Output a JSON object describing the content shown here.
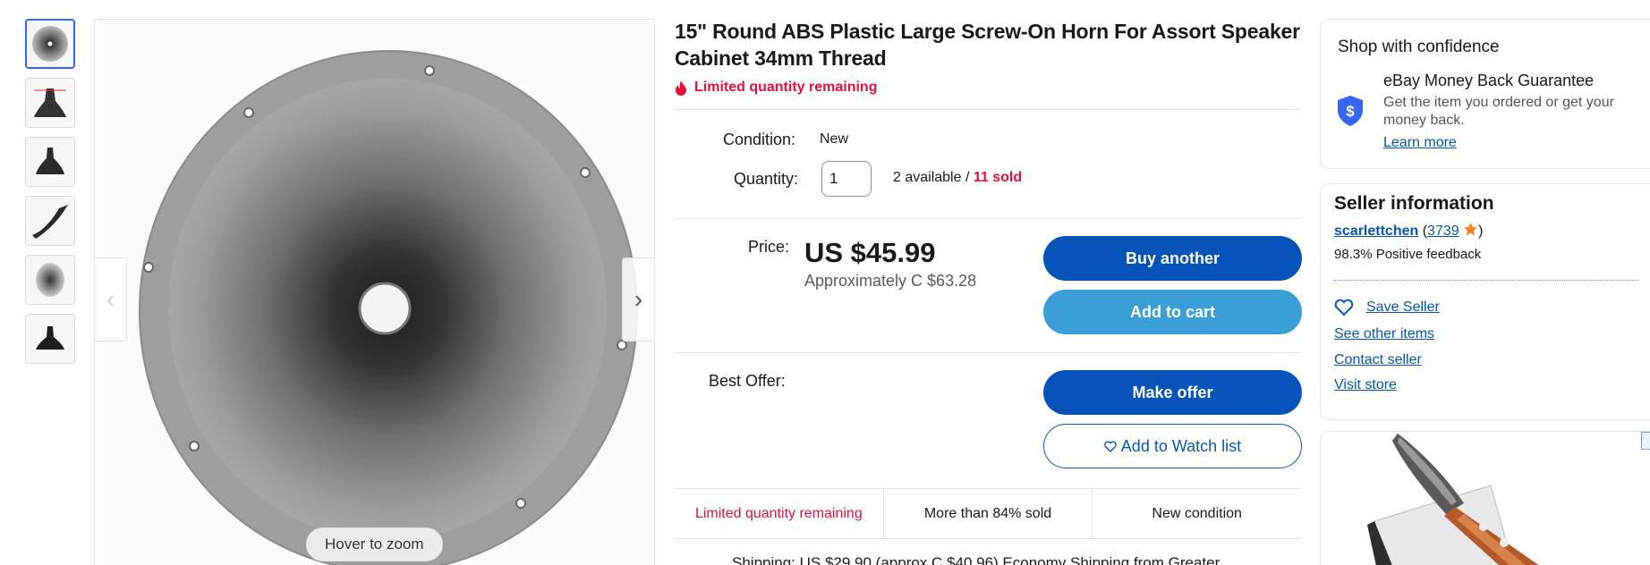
{
  "gallery": {
    "thumbnails": [
      "horn-front",
      "horn-side-dims",
      "horn-side",
      "horn-angled",
      "horn-top",
      "horn-side-dark"
    ],
    "selected_index": 0,
    "zoom_hint": "Hover to zoom"
  },
  "product": {
    "title": "15\" Round ABS Plastic Large Screw-On Horn For Assort Speaker Cabinet 34mm Thread",
    "urgency": "Limited quantity remaining",
    "condition_label": "Condition:",
    "condition_value": "New",
    "quantity_label": "Quantity:",
    "quantity_value": "1",
    "available_text": "2 available / ",
    "sold_text": "11 sold",
    "price_label": "Price:",
    "price": "US $45.99",
    "approx_price": "Approximately C $63.28",
    "best_offer_label": "Best Offer:",
    "buy_label": "Buy another",
    "cart_label": "Add to cart",
    "offer_label": "Make offer",
    "watch_label": "Add to Watch list",
    "badges": [
      "Limited quantity remaining",
      "More than 84% sold",
      "New condition"
    ],
    "shipping_cut": "Shipping:   US $29.90 (approx C $40.96) Economy Shipping from Greater"
  },
  "confidence": {
    "heading": "Shop with confidence",
    "mbg_title": "eBay Money Back Guarantee",
    "mbg_desc": "Get the item you ordered or get your money back.",
    "learn_more": "Learn more"
  },
  "seller": {
    "heading": "Seller information",
    "name": "scarlettchen",
    "feedback_count": "3739",
    "positive": "98.3% Positive feedback",
    "save": "Save Seller",
    "other_items": "See other items",
    "contact": "Contact seller",
    "store": "Visit store"
  },
  "colors": {
    "link": "#0654ba",
    "urgent": "#e0103a",
    "primary_button": "#0654ba",
    "secondary_button": "#3c9ed6",
    "selected_thumb": "#3665f3"
  }
}
